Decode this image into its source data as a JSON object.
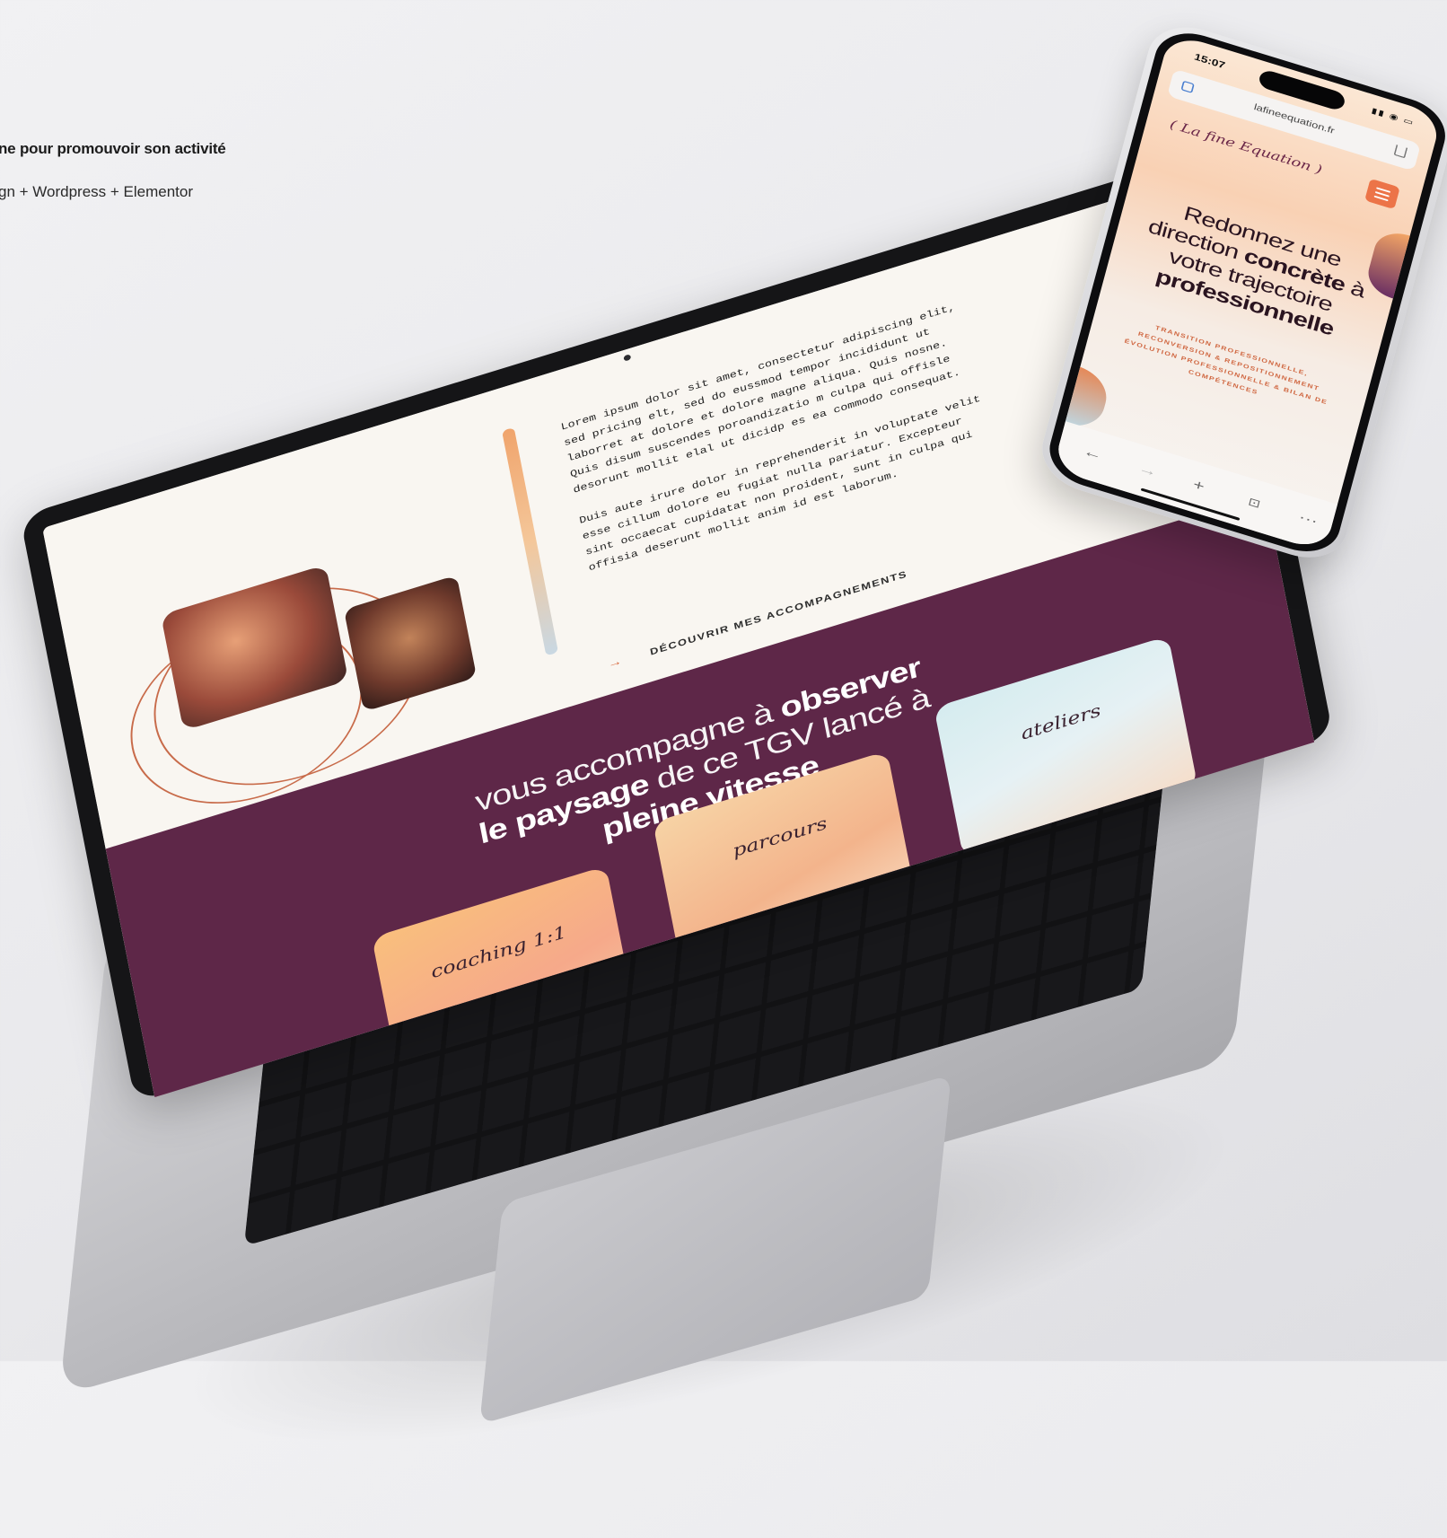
{
  "caption": {
    "title": "ne pour promouvoir son activité",
    "subtitle": "gn + Wordpress + Elementor"
  },
  "laptop": {
    "lorem_paragraphs": [
      "Lorem ipsum dolor sit amet, consectetur adipiscing elit, sed pricing elt, sed do eussmod tempor incididunt ut laborret at dolore et dolore magne aliqua. Quis nosne. Quis disum suscendes poroandizatio m culpa qui offisle desorunt mollit elal ut dicidp es ea commodo consequat.",
      "Duis aute irure dolor in reprehenderit in voluptate velit esse cillum dolore eu fugiat nulla pariatur. Excepteur sint occaecat cupidatat non proident, sunt in culpa qui offisia deserunt mollit anim id est laborum."
    ],
    "cta_label": "DÉCOUVRIR MES ACCOMPAGNEMENTS",
    "headline": {
      "line1_thin": "vous accompagne à ",
      "line1_bold": "observer",
      "line2_bold": "le paysage",
      "line2_thin": " de ce TGV lancé à",
      "line3_bold": "pleine vitesse"
    },
    "cards": [
      "coaching 1:1",
      "parcours",
      "ateliers"
    ],
    "colors": {
      "purple": "#5e2748",
      "cream": "#f9f6f1",
      "accent_orange": "#d8693f"
    }
  },
  "phone": {
    "time": "15:07",
    "url": "lafineequation.fr",
    "logo": "( La fine Equation )",
    "hero": {
      "line1": "Redonnez une",
      "line2_thin": "direction ",
      "line2_bold": "concrète",
      "line2_end": " à",
      "line3": "votre trajectoire",
      "line4_bold": "professionnelle"
    },
    "subtitle_lines": [
      "TRANSITION PROFESSIONNELLE,",
      "RECONVERSION & REPOSITIONNEMENT",
      "ÉVOLUTION PROFESSIONNELLE & BILAN DE",
      "COMPÉTENCES"
    ],
    "toolbar_icons": [
      "back-icon",
      "forward-icon",
      "plus-icon",
      "tabs-icon",
      "more-icon"
    ],
    "colors": {
      "menu_orange": "#ec7448",
      "subtitle_orange": "#d06842"
    }
  }
}
